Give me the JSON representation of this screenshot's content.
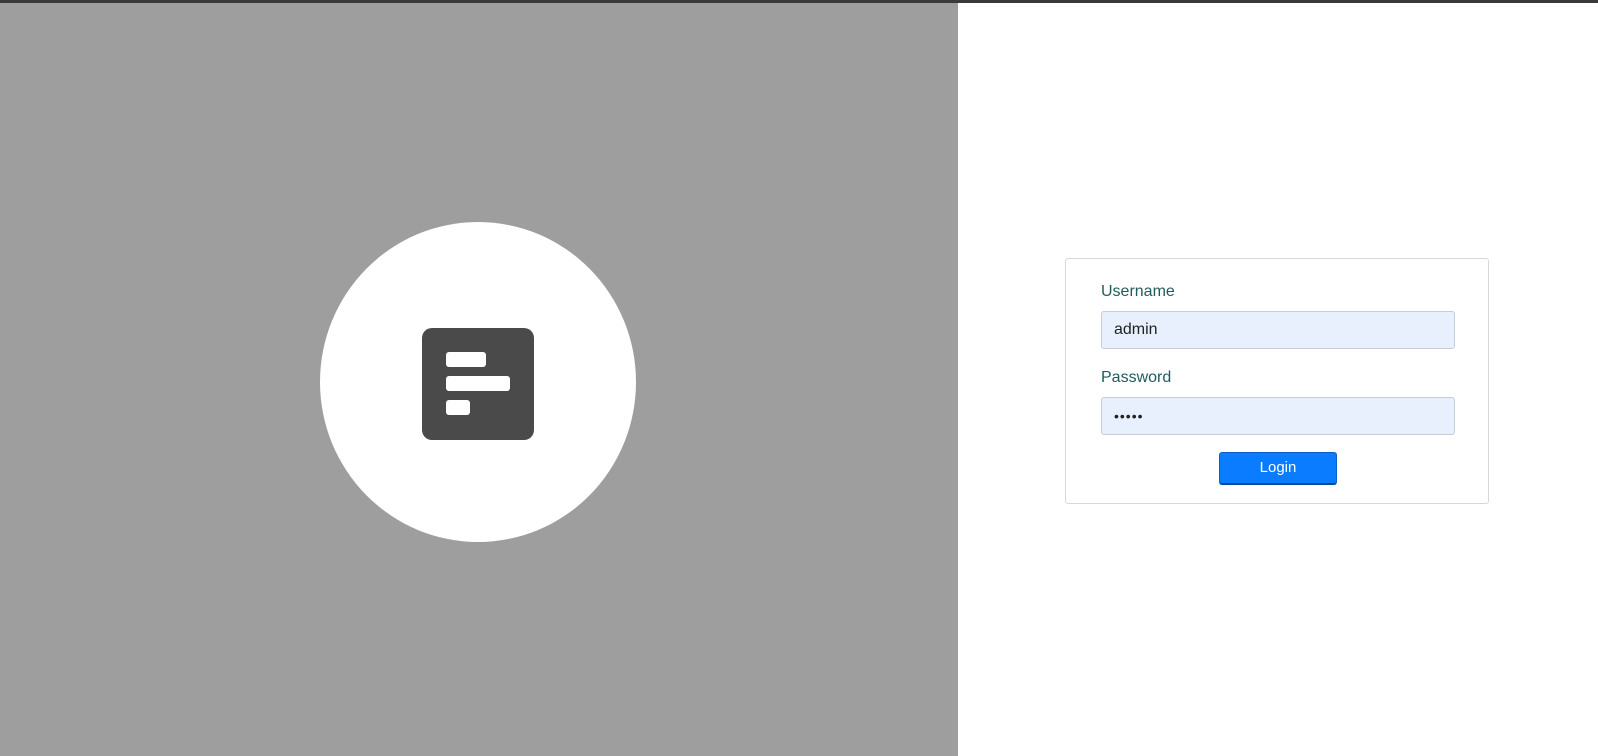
{
  "login": {
    "username_label": "Username",
    "username_value": "admin",
    "password_label": "Password",
    "password_value": "•••••",
    "submit_label": "Login"
  },
  "colors": {
    "left_panel_bg": "#9e9e9e",
    "logo_bg": "#4a4a4a",
    "input_bg": "#e8f0fe",
    "button_bg": "#0a7cff",
    "label_color": "#1f5c5c"
  },
  "icons": {
    "logo": "app-logo-icon"
  }
}
